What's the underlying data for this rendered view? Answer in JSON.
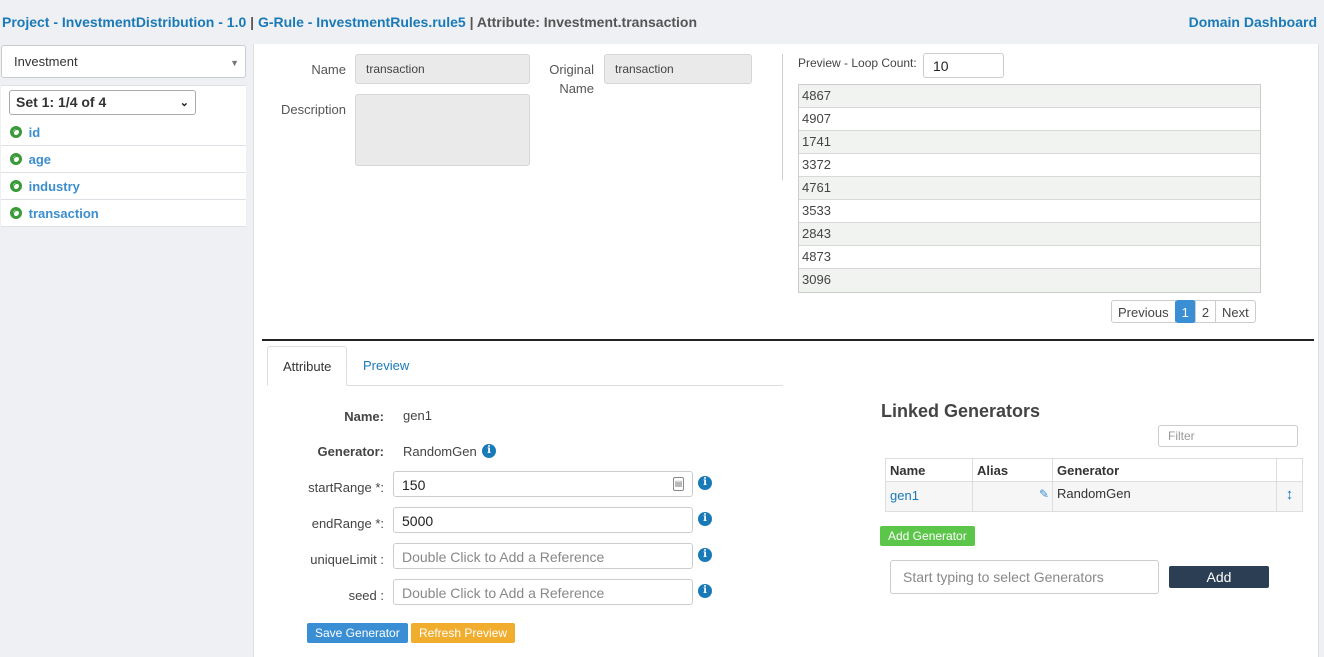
{
  "breadcrumb": {
    "project": "Project - InvestmentDistribution - 1.0",
    "separator": "|",
    "rule": "G-Rule - InvestmentRules.rule5",
    "attribute": "Attribute: Investment.transaction"
  },
  "header": {
    "dashboard_link": "Domain Dashboard"
  },
  "sidebar": {
    "entity_select": "Investment",
    "set_select": "Set 1: 1/4 of 4",
    "items": [
      "id",
      "age",
      "industry",
      "transaction"
    ]
  },
  "details": {
    "name_label": "Name",
    "name_value": "transaction",
    "description_label": "Description",
    "description_value": "",
    "original_name_label_1": "Original",
    "original_name_label_2": "Name",
    "original_name_value": "transaction"
  },
  "preview": {
    "loop_label": "Preview - Loop Count:",
    "loop_count": "10",
    "rows": [
      "4867",
      "4907",
      "1741",
      "3372",
      "4761",
      "3533",
      "2843",
      "4873",
      "3096"
    ],
    "pager": {
      "prev": "Previous",
      "page1": "1",
      "page2": "2",
      "next": "Next"
    }
  },
  "tabs": {
    "attribute": "Attribute",
    "preview": "Preview"
  },
  "form": {
    "name_label": "Name:",
    "name_value": "gen1",
    "generator_label": "Generator:",
    "generator_value": "RandomGen",
    "start_label": "startRange *:",
    "start_value": "150",
    "end_label": "endRange *:",
    "end_value": "5000",
    "unique_label": "uniqueLimit :",
    "seed_label": "seed :",
    "reference_placeholder": "Double Click to Add a Reference",
    "save_button": "Save Generator",
    "refresh_button": "Refresh Preview"
  },
  "linked": {
    "title": "Linked Generators",
    "filter_placeholder": "Filter",
    "columns": {
      "name": "Name",
      "alias": "Alias",
      "generator": "Generator"
    },
    "row": {
      "name": "gen1",
      "alias": "",
      "generator": "RandomGen"
    },
    "add_generator_button": "Add Generator",
    "select_placeholder": "Start typing to select Generators",
    "add_button": "Add"
  },
  "colors": {
    "link": "#1a7ab8",
    "primary_button": "#3a8fd4",
    "warning_button": "#f0ad2e",
    "success_button": "#5cc64a",
    "dark_button": "#2c3e54"
  }
}
